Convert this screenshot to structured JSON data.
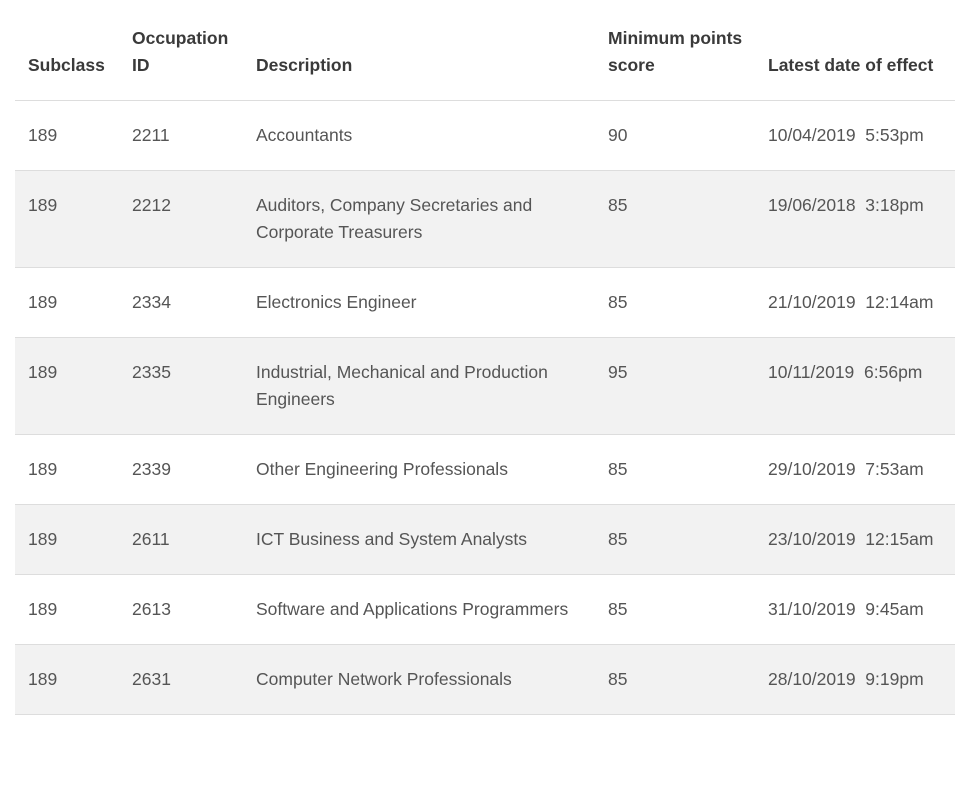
{
  "table": {
    "headers": {
      "subclass": "Subclass",
      "occupation_id": "Occupation ID",
      "description": "Description",
      "minimum_points": "Minimum points score",
      "latest_date": "Latest date of effect"
    },
    "rows": [
      {
        "subclass": "189",
        "occupation_id": "2211",
        "description": "Accountants",
        "minimum_points": "90",
        "latest_date": "10/04/2019  5:53pm"
      },
      {
        "subclass": "189",
        "occupation_id": "2212",
        "description": "Auditors, Company Secretaries and Corporate Treasurers",
        "minimum_points": "85",
        "latest_date": "19/06/2018  3:18pm"
      },
      {
        "subclass": "189",
        "occupation_id": "2334",
        "description": "Electronics Engineer",
        "minimum_points": "85",
        "latest_date": "21/10/2019  12:14am"
      },
      {
        "subclass": "189",
        "occupation_id": "2335",
        "description": "Industrial, Mechanical and Production Engineers",
        "minimum_points": "95",
        "latest_date": "10/11/2019  6:56pm"
      },
      {
        "subclass": "189",
        "occupation_id": "2339",
        "description": "Other Engineering Professionals",
        "minimum_points": "85",
        "latest_date": "29/10/2019  7:53am"
      },
      {
        "subclass": "189",
        "occupation_id": "2611",
        "description": "ICT Business and System Analysts",
        "minimum_points": "85",
        "latest_date": "23/10/2019  12:15am"
      },
      {
        "subclass": "189",
        "occupation_id": "2613",
        "description": "Software and Applications Programmers",
        "minimum_points": "85",
        "latest_date": "31/10/2019  9:45am"
      },
      {
        "subclass": "189",
        "occupation_id": "2631",
        "description": "Computer Network Professionals",
        "minimum_points": "85",
        "latest_date": "28/10/2019  9:19pm"
      }
    ]
  },
  "colors": {
    "row_stripe": "#f2f2f2",
    "border": "#dddddd",
    "text": "#555555",
    "header_text": "#3a3a3a"
  }
}
